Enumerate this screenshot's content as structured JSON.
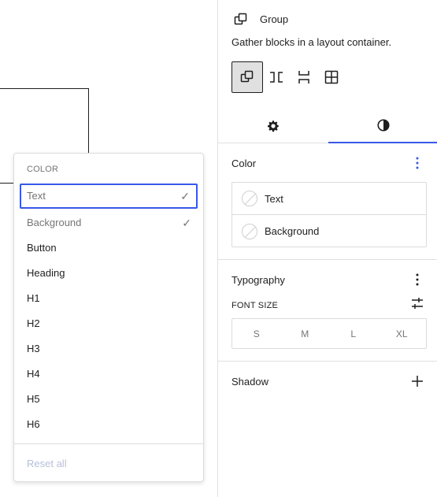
{
  "popover": {
    "heading": "COLOR",
    "items": [
      {
        "label": "Text",
        "checked": true
      },
      {
        "label": "Background",
        "checked": true
      },
      {
        "label": "Button",
        "checked": false
      },
      {
        "label": "Heading",
        "checked": false
      },
      {
        "label": "H1",
        "checked": false
      },
      {
        "label": "H2",
        "checked": false
      },
      {
        "label": "H3",
        "checked": false
      },
      {
        "label": "H4",
        "checked": false
      },
      {
        "label": "H5",
        "checked": false
      },
      {
        "label": "H6",
        "checked": false
      }
    ],
    "check_glyph": "✓",
    "reset_label": "Reset all"
  },
  "sidebar": {
    "block_title": "Group",
    "block_description": "Gather blocks in a layout container.",
    "variations": [
      "group-icon",
      "row-icon",
      "stack-icon",
      "grid-icon"
    ],
    "tabs": [
      {
        "name": "settings",
        "icon": "gear-icon"
      },
      {
        "name": "styles",
        "icon": "contrast-icon"
      }
    ],
    "color": {
      "title": "Color",
      "items": [
        {
          "label": "Text"
        },
        {
          "label": "Background"
        }
      ]
    },
    "typography": {
      "title": "Typography",
      "font_size_label": "FONT SIZE",
      "sizes": [
        "S",
        "M",
        "L",
        "XL"
      ]
    },
    "shadow": {
      "title": "Shadow"
    }
  },
  "colors": {
    "accent": "#3858e9",
    "text": "#1e1e1e",
    "muted": "#757575",
    "border": "#dcdcde"
  }
}
